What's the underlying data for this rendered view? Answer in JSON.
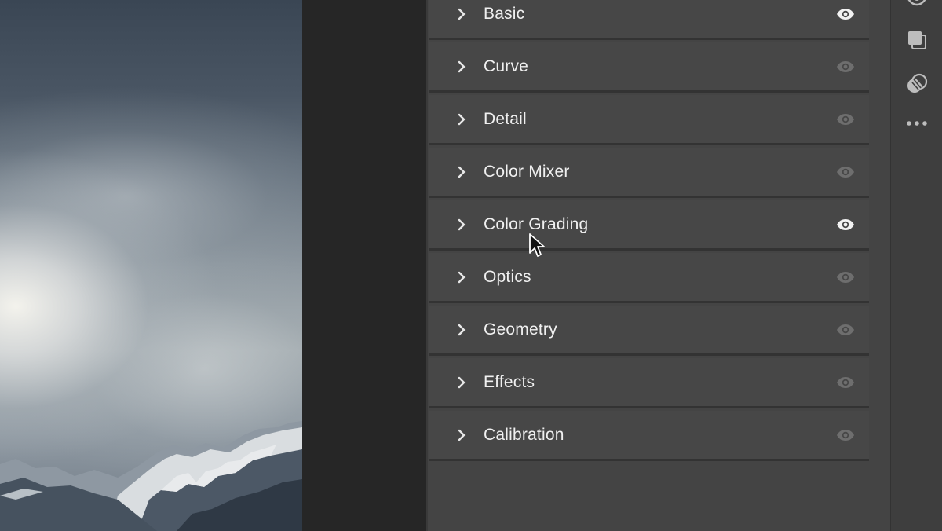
{
  "panel": {
    "items": [
      {
        "label": "Basic",
        "eye_active": true
      },
      {
        "label": "Curve",
        "eye_active": false
      },
      {
        "label": "Detail",
        "eye_active": false
      },
      {
        "label": "Color Mixer",
        "eye_active": false
      },
      {
        "label": "Color Grading",
        "eye_active": true
      },
      {
        "label": "Optics",
        "eye_active": false
      },
      {
        "label": "Geometry",
        "eye_active": false
      },
      {
        "label": "Effects",
        "eye_active": false
      },
      {
        "label": "Calibration",
        "eye_active": false
      }
    ]
  },
  "toolbar": {
    "icons": [
      "eye-icon",
      "layers-icon",
      "masking-icon",
      "more-icon"
    ]
  },
  "colors": {
    "panel_bg": "#474747",
    "eye_active": "#f2f2f2",
    "eye_inactive": "#6e6e6e",
    "label_text": "#f0f0f0"
  }
}
